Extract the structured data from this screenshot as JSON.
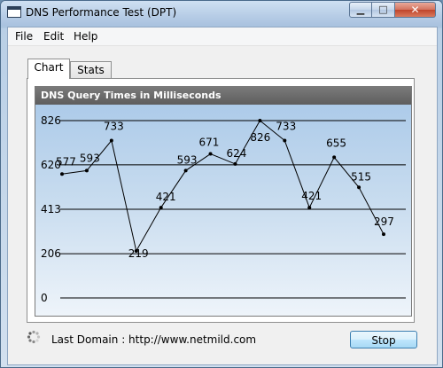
{
  "window": {
    "title": "DNS Performance Test (DPT)",
    "minimize_glyph": "▁",
    "maximize_glyph": "□",
    "close_glyph": "✕"
  },
  "menu": {
    "items": [
      "File",
      "Edit",
      "Help"
    ]
  },
  "tabs": [
    {
      "label": "Chart",
      "active": true
    },
    {
      "label": "Stats",
      "active": false
    }
  ],
  "chart_header": "DNS Query Times in Milliseconds",
  "chart_data": {
    "type": "line",
    "title": "DNS Query Times in Milliseconds",
    "y_ticks": [
      826,
      620,
      413,
      206,
      0
    ],
    "ylim": [
      0,
      826
    ],
    "values": [
      577,
      593,
      733,
      219,
      421,
      593,
      671,
      624,
      826,
      733,
      421,
      655,
      515,
      297
    ],
    "data_labels": [
      "577",
      "593",
      "733",
      "219",
      "421",
      "593",
      "671",
      "624",
      "826",
      "733",
      "421",
      "655",
      "515",
      "297"
    ],
    "grid": true,
    "legend": "none",
    "line_color": "#000000",
    "background": "#b8d3ed"
  },
  "status": {
    "text": "Last Domain : http://www.netmild.com",
    "icon": "spinner-icon"
  },
  "stop_button": {
    "label": "Stop"
  },
  "colors": {
    "title_bar": "#b7cde6",
    "close_button": "#c0452b",
    "chart_header": "#6a6a6a"
  }
}
